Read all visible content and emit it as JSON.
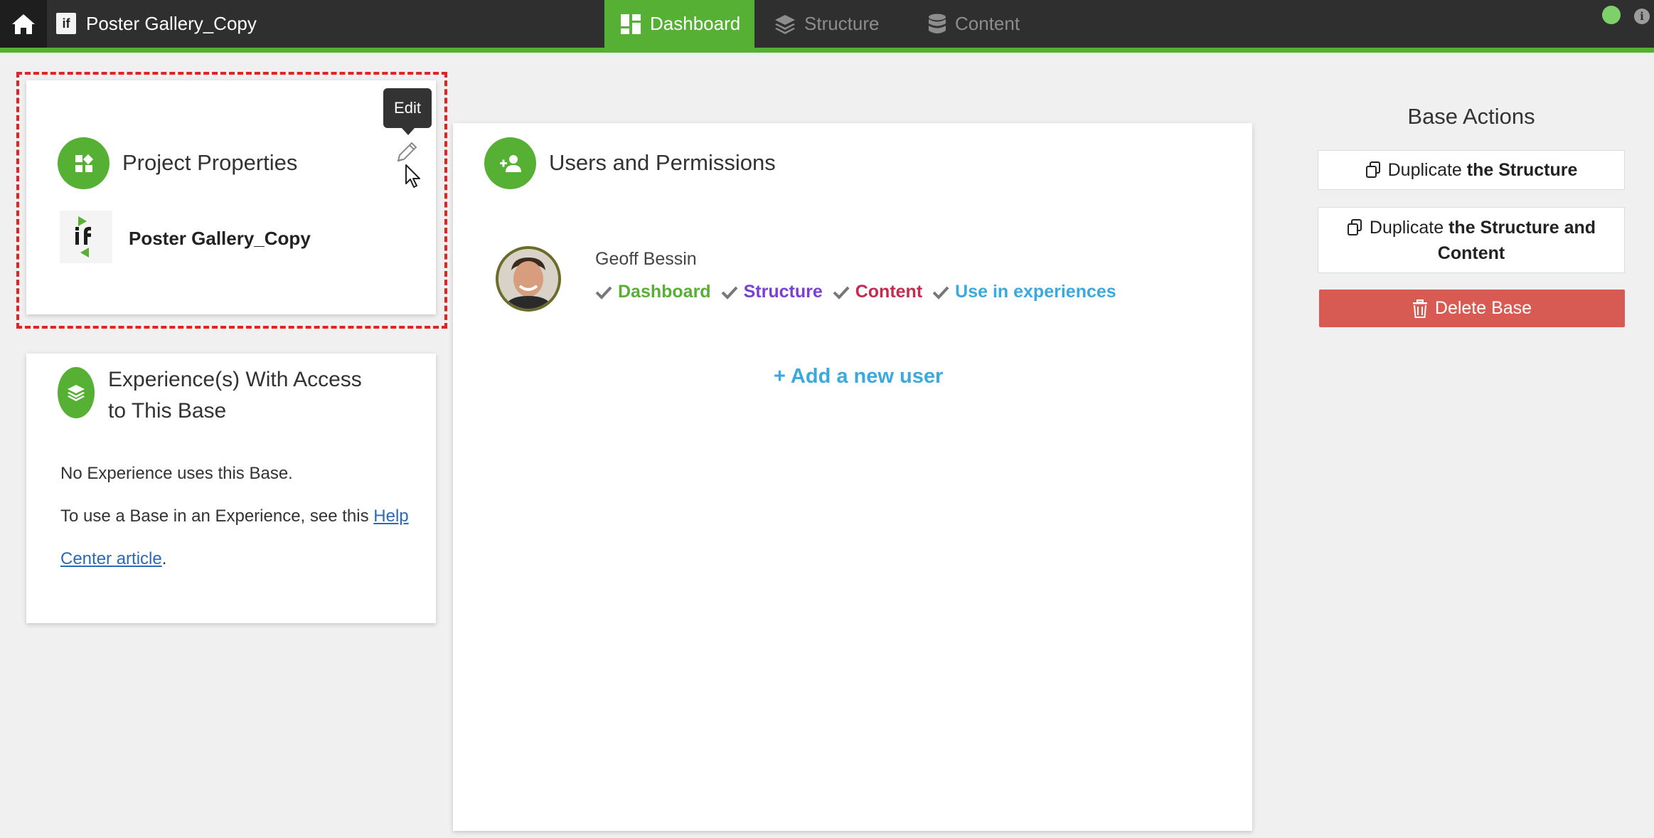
{
  "topbar": {
    "project_title": "Poster Gallery_Copy",
    "logo_text": "if",
    "tabs": [
      {
        "label": "Dashboard",
        "active": true
      },
      {
        "label": "Structure",
        "active": false
      },
      {
        "label": "Content",
        "active": false
      }
    ],
    "info_glyph": "i"
  },
  "project_properties": {
    "title": "Project Properties",
    "tooltip": "Edit",
    "project_name": "Poster Gallery_Copy"
  },
  "experiences": {
    "title_line1": "Experience(s) With Access",
    "title_line2": "to This Base",
    "no_experience": "No Experience uses this Base.",
    "help_prefix": "To use a Base in an Experience, see this",
    "help_link_1": "Help",
    "help_link_2": "Center article",
    "help_suffix": "."
  },
  "users": {
    "title": "Users and Permissions",
    "list": [
      {
        "name": "Geoff Bessin",
        "permissions": [
          {
            "label": "Dashboard",
            "color": "#55b034"
          },
          {
            "label": "Structure",
            "color": "#7b3fd8"
          },
          {
            "label": "Content",
            "color": "#c8294e"
          },
          {
            "label": "Use in experiences",
            "color": "#3aa9e0"
          }
        ]
      }
    ],
    "add_user": "+ Add a new user"
  },
  "base_actions": {
    "title": "Base Actions",
    "duplicate_prefix": "Duplicate",
    "duplicate_structure_bold": "the Structure",
    "duplicate_both_bold_1": "the Structure and",
    "duplicate_both_bold_2": "Content",
    "delete": "Delete Base"
  },
  "colors": {
    "accent": "#55b034",
    "topbar": "#2f2f2f",
    "delete": "#d85b53",
    "link": "#2a6ab8"
  }
}
